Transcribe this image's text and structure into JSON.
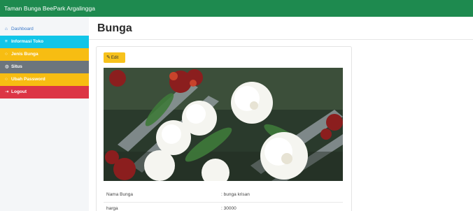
{
  "app": {
    "title": "Taman Bunga BeePark Argalingga"
  },
  "sidebar": {
    "items": [
      {
        "label": "Dashboard",
        "icon": "home-icon"
      },
      {
        "label": "Informasi Toko",
        "icon": "list-icon"
      },
      {
        "label": "Jenis Bunga",
        "icon": "circle-icon"
      },
      {
        "label": "Situs",
        "icon": "globe-icon"
      },
      {
        "label": "Ubah Password",
        "icon": "circle-icon"
      },
      {
        "label": "Logout",
        "icon": "logout-icon"
      }
    ]
  },
  "main": {
    "title": "Bunga",
    "edit_label": "Edit",
    "details": [
      {
        "label": "Nama Bunga",
        "value": ": bunga krisan"
      },
      {
        "label": "harga",
        "value": ": 30000"
      }
    ]
  },
  "colors": {
    "topbar": "#1e8a4f",
    "info": "#11c5e8",
    "warning": "#f7bd12",
    "secondary": "#6c757d",
    "danger": "#dc3545",
    "primary": "#3a78c9"
  }
}
